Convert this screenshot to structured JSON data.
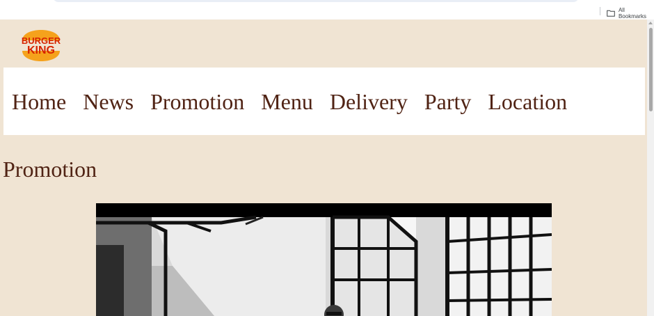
{
  "browser": {
    "bookmarks_label": "All Bookmarks",
    "bookmarks_icon": "folder-icon"
  },
  "logo": {
    "line1": "BURGER",
    "line2": "KING",
    "colors": {
      "bun": "#f5a21c",
      "text": "#d62300"
    }
  },
  "nav": {
    "items": [
      {
        "label": "Home"
      },
      {
        "label": "News"
      },
      {
        "label": "Promotion"
      },
      {
        "label": "Menu"
      },
      {
        "label": "Delivery"
      },
      {
        "label": "Party"
      },
      {
        "label": "Location"
      }
    ]
  },
  "main": {
    "heading": "Promotion"
  },
  "colors": {
    "page_background": "#f0e4d3",
    "brand_brown": "#502314"
  }
}
